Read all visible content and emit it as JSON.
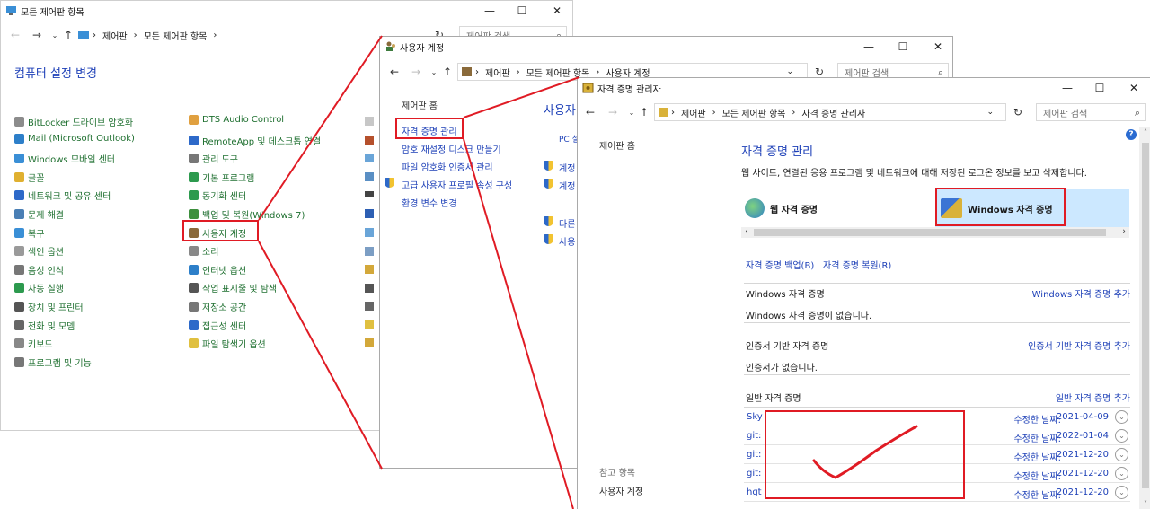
{
  "win1": {
    "title": "모든 제어판 항목",
    "breadcrumb": [
      "제어판",
      "모든 제어판 항목"
    ],
    "search_placeholder": "제어판 검색",
    "heading": "컴퓨터 설정 변경",
    "col1": [
      "BitLocker 드라이브 암호화",
      "Mail (Microsoft Outlook)",
      "Windows 모바일 센터",
      "글꼴",
      "네트워크 및 공유 센터",
      "문제 해결",
      "복구",
      "색인 옵션",
      "음성 인식",
      "자동 실행",
      "장치 및 프린터",
      "전화 및 모뎀",
      "키보드",
      "프로그램 및 기능"
    ],
    "col2": [
      "DTS Audio Control",
      "RemoteApp 및 데스크톱 연결",
      "관리 도구",
      "기본 프로그램",
      "동기화 센터",
      "백업 및 복원(Windows 7)",
      "사용자 계정",
      "소리",
      "인터넷 옵션",
      "작업 표시줄 및 탐색",
      "저장소 공간",
      "접근성 센터",
      "파일 탐색기 옵션"
    ]
  },
  "win2": {
    "title": "사용자 계정",
    "breadcrumb": [
      "제어판",
      "모든 제어판 항목",
      "사용자 계정"
    ],
    "search_placeholder": "제어판 검색",
    "home": "제어판 홈",
    "links": [
      "자격 증명 관리",
      "암호 재설정 디스크 만들기",
      "파일 암호화 인증서 관리",
      "고급 사용자 프로필 속성 구성",
      "환경 변수 변경"
    ],
    "main_title": "사용자",
    "pc_label": "PC 설",
    "main_links": [
      "계정",
      "계정",
      "다른",
      "사용"
    ]
  },
  "win3": {
    "title": "자격 증명 관리자",
    "breadcrumb": [
      "제어판",
      "모든 제어판 항목",
      "자격 증명 관리자"
    ],
    "search_placeholder": "제어판 검색",
    "home": "제어판 홈",
    "heading": "자격 증명 관리",
    "description": "웹 사이트, 연결된 응용 프로그램 및 네트워크에 대해 저장된 로그온 정보를 보고 삭제합니다.",
    "tab_web": "웹 자격 증명",
    "tab_windows": "Windows 자격 증명",
    "backup": "자격 증명 백업(B)",
    "restore": "자격 증명 복원(R)",
    "win_section": "Windows 자격 증명",
    "win_add": "Windows 자격 증명 추가",
    "win_empty": "Windows 자격 증명이 없습니다.",
    "cert_section": "인증서 기반 자격 증명",
    "cert_add": "인증서 기반 자격 증명 추가",
    "cert_empty": "인증서가 없습니다.",
    "gen_section": "일반 자격 증명",
    "gen_add": "일반 자격 증명 추가",
    "modified_label": "수정한 날짜:",
    "generic": [
      {
        "name": "Sky",
        "date": "2021-04-09"
      },
      {
        "name": "git:",
        "date": "2022-01-04"
      },
      {
        "name": "git:",
        "date": "2021-12-20"
      },
      {
        "name": "git:",
        "date": "2021-12-20"
      },
      {
        "name": "hgt",
        "date": "2021-12-20"
      }
    ],
    "see_also": "참고 항목",
    "see_also_link": "사용자 계정"
  },
  "colors": {
    "accent_link": "#1c3fb7",
    "green_link": "#126e2d",
    "highlight": "#e01b24",
    "selected_tab": "#cce8ff"
  }
}
